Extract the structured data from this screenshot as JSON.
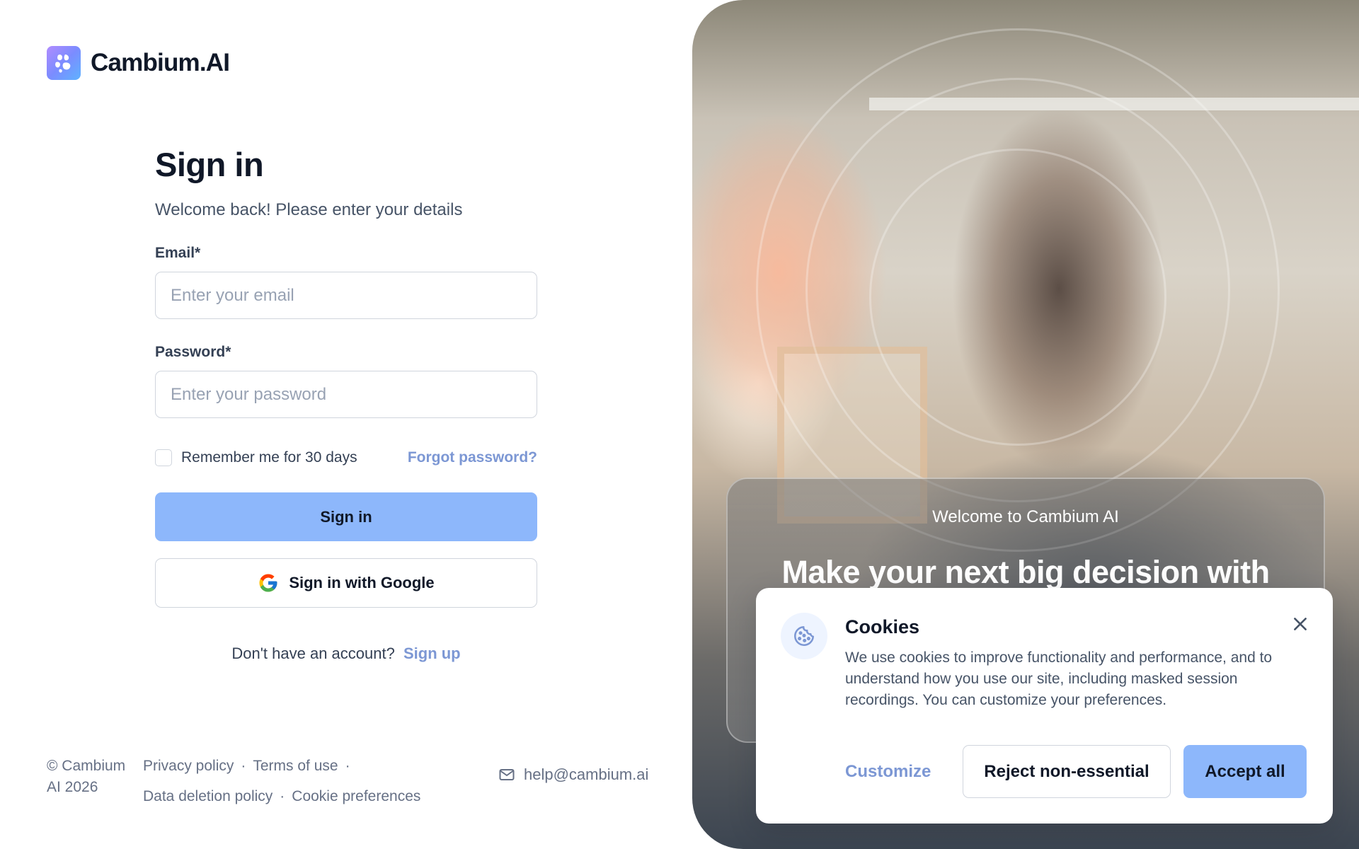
{
  "brand": {
    "name": "Cambium.AI"
  },
  "signin": {
    "title": "Sign in",
    "subtitle": "Welcome back! Please enter your details",
    "email_label": "Email*",
    "email_placeholder": "Enter your email",
    "password_label": "Password*",
    "password_placeholder": "Enter your password",
    "remember_label": "Remember me for 30 days",
    "forgot_label": "Forgot password?",
    "submit_label": "Sign in",
    "google_label": "Sign in with Google",
    "no_account_text": "Don't have an account?",
    "signup_label": "Sign up"
  },
  "footer": {
    "copyright": "© Cambium AI 2026",
    "links": [
      "Privacy policy",
      "Terms of use",
      "Data deletion policy",
      "Cookie preferences"
    ],
    "email": "help@cambium.ai"
  },
  "hero": {
    "eyebrow": "Welcome to Cambium AI",
    "headline": "Make your next big decision with"
  },
  "cookie_dialog": {
    "title": "Cookies",
    "text": "We use cookies to improve functionality and performance, and to understand how you use our site, including masked session recordings. You can customize your preferences.",
    "customize_label": "Customize",
    "reject_label": "Reject non-essential",
    "accept_label": "Accept all"
  },
  "colors": {
    "accent": "#8db7fb",
    "link": "#7c97d4",
    "text_primary": "#101828",
    "text_secondary": "#475467"
  },
  "icons": [
    "cambium-logo-icon",
    "google-icon",
    "mail-icon",
    "cookie-icon",
    "close-icon"
  ]
}
